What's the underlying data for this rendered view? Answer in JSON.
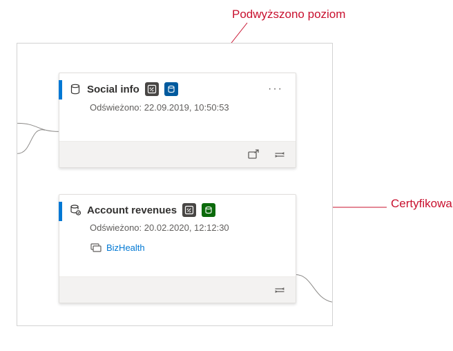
{
  "annotations": {
    "promoted": "Podwyższono poziom",
    "certified": "Certyfikowane"
  },
  "cards": [
    {
      "title": "Social info",
      "refreshed": "Odświeżono: 22.09.2019, 10:50:53",
      "badges": {
        "dark": true,
        "blue": true,
        "green": false
      },
      "typeIcon": "dataset-icon",
      "showShare": true,
      "showMore": true,
      "link": null
    },
    {
      "title": "Account revenues",
      "refreshed": "Odświeżono: 20.02.2020, 12:12:30",
      "badges": {
        "dark": true,
        "blue": false,
        "green": true
      },
      "typeIcon": "dataflow-icon",
      "showShare": false,
      "showMore": false,
      "link": "BizHealth"
    }
  ]
}
